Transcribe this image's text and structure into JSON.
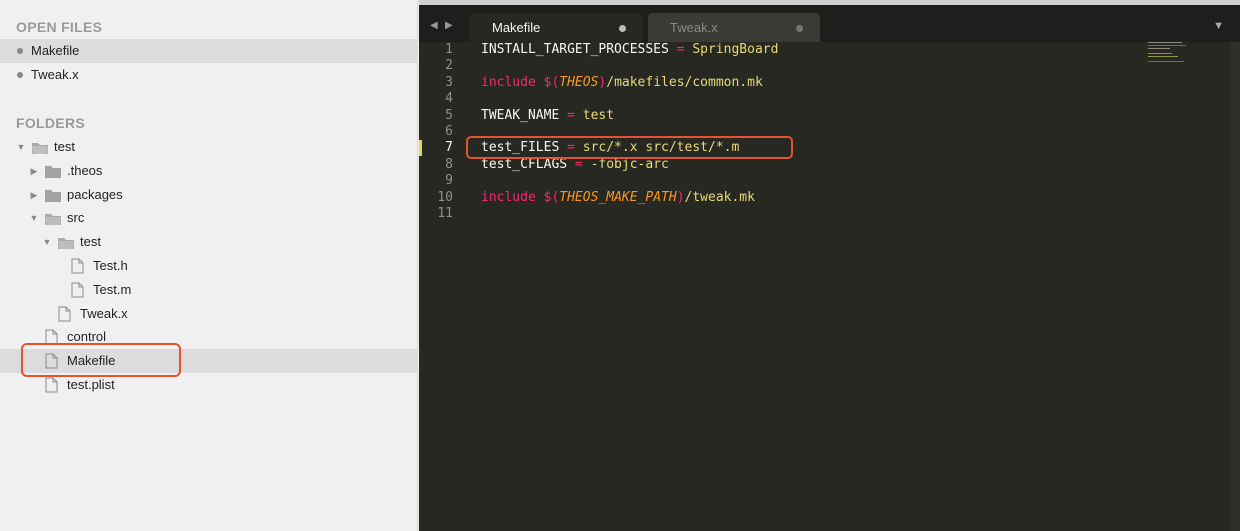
{
  "sidebar": {
    "open_files_title": "OPEN FILES",
    "open_files": [
      {
        "label": "Makefile",
        "selected": true
      },
      {
        "label": "Tweak.x",
        "selected": false
      }
    ],
    "folders_title": "FOLDERS",
    "tree": [
      {
        "label": "test",
        "kind": "folder",
        "expanded": true
      },
      {
        "label": ".theos",
        "kind": "folder",
        "expanded": false
      },
      {
        "label": "packages",
        "kind": "folder",
        "expanded": false
      },
      {
        "label": "src",
        "kind": "folder",
        "expanded": true
      },
      {
        "label": "test",
        "kind": "folder",
        "expanded": true
      },
      {
        "label": "Test.h",
        "kind": "file"
      },
      {
        "label": "Test.m",
        "kind": "file"
      },
      {
        "label": "Tweak.x",
        "kind": "file"
      },
      {
        "label": "control",
        "kind": "file"
      },
      {
        "label": "Makefile",
        "kind": "file",
        "selected": true,
        "highlighted": true
      },
      {
        "label": "test.plist",
        "kind": "file"
      }
    ]
  },
  "editor": {
    "tabs": [
      {
        "label": "Makefile",
        "active": true
      },
      {
        "label": "Tweak.x",
        "active": false
      }
    ],
    "current_line": 7,
    "highlighted_line": 7,
    "lines": [
      {
        "n": "1",
        "tokens": [
          {
            "t": "INSTALL_TARGET_PROCESSES ",
            "c": "plain"
          },
          {
            "t": "=",
            "c": "op"
          },
          {
            "t": " SpringBoard",
            "c": "str"
          }
        ]
      },
      {
        "n": "2",
        "tokens": []
      },
      {
        "n": "3",
        "tokens": [
          {
            "t": "include",
            "c": "kw"
          },
          {
            "t": " ",
            "c": "plain"
          },
          {
            "t": "$(",
            "c": "op"
          },
          {
            "t": "THEOS",
            "c": "var"
          },
          {
            "t": ")",
            "c": "op"
          },
          {
            "t": "/makefiles/common.mk",
            "c": "str"
          }
        ]
      },
      {
        "n": "4",
        "tokens": []
      },
      {
        "n": "5",
        "tokens": [
          {
            "t": "TWEAK_NAME ",
            "c": "plain"
          },
          {
            "t": "=",
            "c": "op"
          },
          {
            "t": " test",
            "c": "str"
          }
        ]
      },
      {
        "n": "6",
        "tokens": []
      },
      {
        "n": "7",
        "tokens": [
          {
            "t": "test_FILES ",
            "c": "plain"
          },
          {
            "t": "=",
            "c": "op"
          },
          {
            "t": " src/*.x src/test/*.m",
            "c": "str"
          }
        ]
      },
      {
        "n": "8",
        "tokens": [
          {
            "t": "test_CFLAGS ",
            "c": "plain"
          },
          {
            "t": "=",
            "c": "op"
          },
          {
            "t": " -fobjc-arc",
            "c": "str"
          }
        ]
      },
      {
        "n": "9",
        "tokens": []
      },
      {
        "n": "10",
        "tokens": [
          {
            "t": "include",
            "c": "kw"
          },
          {
            "t": " ",
            "c": "plain"
          },
          {
            "t": "$(",
            "c": "op"
          },
          {
            "t": "THEOS_MAKE_PATH",
            "c": "var"
          },
          {
            "t": ")",
            "c": "op"
          },
          {
            "t": "/tweak.mk",
            "c": "str"
          }
        ]
      },
      {
        "n": "11",
        "tokens": []
      }
    ]
  },
  "icons": {
    "nav_back": "chevron-left-icon",
    "nav_forward": "chevron-right-icon",
    "tab_menu": "chevron-down-icon",
    "folder": "folder-icon",
    "file": "file-icon"
  },
  "colors": {
    "highlight_box": "#e2542c",
    "editor_bg": "#272822",
    "keyword": "#f92672",
    "string": "#e6db74",
    "variable": "#fd971f"
  }
}
